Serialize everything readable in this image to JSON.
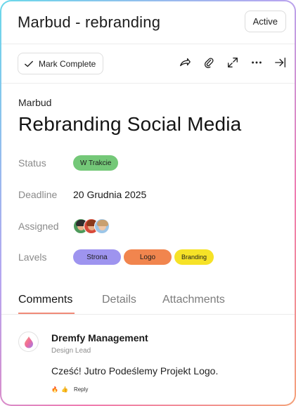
{
  "header": {
    "title": "Marbud - rebranding",
    "status_chip": "Active"
  },
  "toolbar": {
    "mark_complete_label": "Mark Complete",
    "icons": [
      "share-icon",
      "paperclip-icon",
      "expand-icon",
      "more-icon",
      "collapse-right-icon"
    ]
  },
  "task": {
    "breadcrumb": "Marbud",
    "title": "Rebranding Social Media",
    "fields": {
      "status_label": "Status",
      "status_value": "W Trakcie",
      "deadline_label": "Deadline",
      "deadline_value": "20 Grudnia 2025",
      "assigned_label": "Assigned",
      "levels_label": "Lavels",
      "levels": [
        "Strona",
        "Logo",
        "Branding"
      ]
    }
  },
  "tabs": {
    "comments": "Comments",
    "details": "Details",
    "attachments": "Attachments",
    "active": "Comments"
  },
  "comment": {
    "author": "Dremfy Management",
    "role": "Design Lead",
    "text": "Cześć! Jutro Podeślemy Projekt Logo.",
    "reactions": [
      "🔥",
      "👍"
    ],
    "reply_label": "Reply"
  },
  "colors": {
    "status_green": "#74c878",
    "strona": "#9e94ef",
    "logo": "#f1854e",
    "branding": "#f6e227",
    "tab_underline": "#f08a78"
  }
}
